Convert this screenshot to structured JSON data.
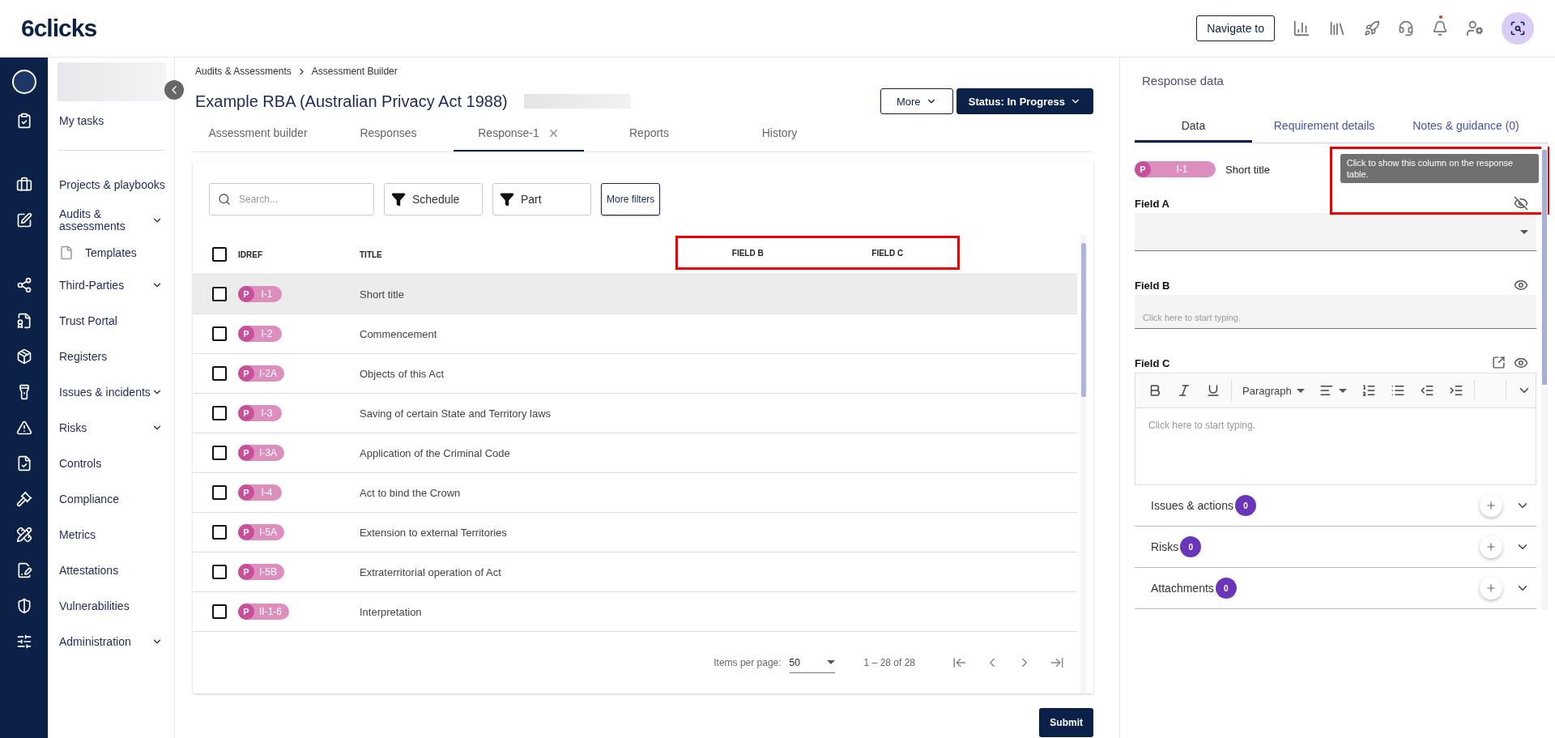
{
  "header": {
    "logo": "6clicks",
    "navigate_button": "Navigate to"
  },
  "sidebar": {
    "pinned": [
      {
        "label": "My tasks",
        "expandable": false
      }
    ],
    "items": [
      {
        "label": "Projects & playbooks",
        "expandable": false
      },
      {
        "label": "Audits & assessments",
        "expandable": true,
        "children": [
          {
            "label": "Templates",
            "expandable": false
          }
        ]
      },
      {
        "label": "Third-Parties",
        "expandable": true
      },
      {
        "label": "Trust Portal",
        "expandable": false
      },
      {
        "label": "Registers",
        "expandable": false
      },
      {
        "label": "Issues & incidents",
        "expandable": true
      },
      {
        "label": "Risks",
        "expandable": true
      },
      {
        "label": "Controls",
        "expandable": false
      },
      {
        "label": "Compliance",
        "expandable": false
      },
      {
        "label": "Metrics",
        "expandable": false
      },
      {
        "label": "Attestations",
        "expandable": false
      },
      {
        "label": "Vulnerabilities",
        "expandable": false
      },
      {
        "label": "Administration",
        "expandable": true
      }
    ]
  },
  "breadcrumb": [
    "Audits & Assessments",
    "Assessment Builder"
  ],
  "page_title": "Example RBA (Australian Privacy Act 1988)",
  "actions": [
    {
      "label": "More",
      "kind": "outline"
    },
    {
      "label": "Status: In Progress",
      "kind": "primary"
    }
  ],
  "tabs": [
    {
      "label": "Assessment builder",
      "selected": false,
      "closable": false
    },
    {
      "label": "Responses",
      "selected": false,
      "closable": false
    },
    {
      "label": "Response-1",
      "selected": true,
      "closable": true
    },
    {
      "label": "Reports",
      "selected": false,
      "closable": false
    },
    {
      "label": "History",
      "selected": false,
      "closable": false
    }
  ],
  "filters": {
    "search_placeholder": "Search...",
    "filter_buttons": [
      "Schedule",
      "Part"
    ],
    "more_filters": "More filters"
  },
  "table": {
    "all_checked": false,
    "columns": [
      "IDREF",
      "TITLE",
      "FIELD B",
      "FIELD C"
    ],
    "rows": [
      {
        "prefix": "P",
        "idref": "I-1",
        "title": "Short title",
        "checked": false,
        "selected": true
      },
      {
        "prefix": "P",
        "idref": "I-2",
        "title": "Commencement",
        "checked": false,
        "selected": false
      },
      {
        "prefix": "P",
        "idref": "I-2A",
        "title": "Objects of this Act",
        "checked": false,
        "selected": false
      },
      {
        "prefix": "P",
        "idref": "I-3",
        "title": "Saving of certain State and Territory laws",
        "checked": false,
        "selected": false
      },
      {
        "prefix": "P",
        "idref": "I-3A",
        "title": "Application of the Criminal Code",
        "checked": false,
        "selected": false
      },
      {
        "prefix": "P",
        "idref": "I-4",
        "title": "Act to bind the Crown",
        "checked": false,
        "selected": false
      },
      {
        "prefix": "P",
        "idref": "I-5A",
        "title": "Extension to external Territories",
        "checked": false,
        "selected": false
      },
      {
        "prefix": "P",
        "idref": "I-5B",
        "title": "Extraterritorial operation of Act",
        "checked": false,
        "selected": false
      },
      {
        "prefix": "P",
        "idref": "II-1-6",
        "title": "Interpretation",
        "checked": false,
        "selected": false
      }
    ]
  },
  "pagination": {
    "label": "Items per page:",
    "page_size": "50",
    "range": "1 – 28 of 28"
  },
  "submit": "Submit",
  "panel": {
    "title": "Response data",
    "tabs": [
      {
        "label": "Data",
        "selected": true
      },
      {
        "label": "Requirement details",
        "selected": false
      },
      {
        "label": "Notes & guidance (0)",
        "selected": false
      }
    ],
    "item": {
      "prefix": "P",
      "idref": "I-1",
      "title": "Short title"
    },
    "tooltip": "Click to show this column on the response table.",
    "fields": [
      {
        "label": "Field A",
        "kind": "select",
        "visible": false
      },
      {
        "label": "Field B",
        "kind": "text",
        "placeholder": "Click here to start typing.",
        "visible": true
      },
      {
        "label": "Field C",
        "kind": "rich",
        "placeholder": "Click here to start typing.",
        "visible": true,
        "block_style": "Paragraph"
      }
    ],
    "sections": [
      {
        "label": "Issues & actions",
        "count": "0"
      },
      {
        "label": "Risks",
        "count": "0"
      },
      {
        "label": "Attachments",
        "count": "0"
      }
    ]
  }
}
